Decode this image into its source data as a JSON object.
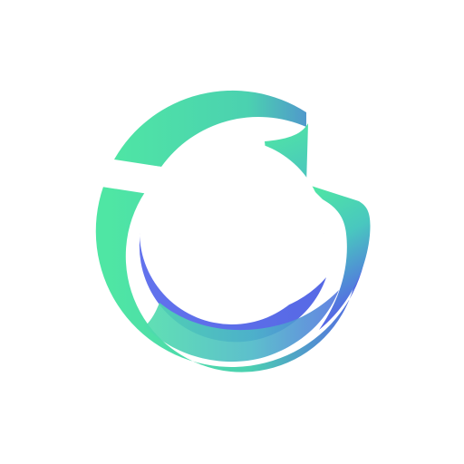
{
  "logo": {
    "icon": "circular-arrow-ribbon-logo-icon",
    "colors": {
      "background": "#ffffff",
      "green": "#4fe6a4",
      "blue": "#5563e6",
      "mid": "#49b9c9"
    }
  }
}
